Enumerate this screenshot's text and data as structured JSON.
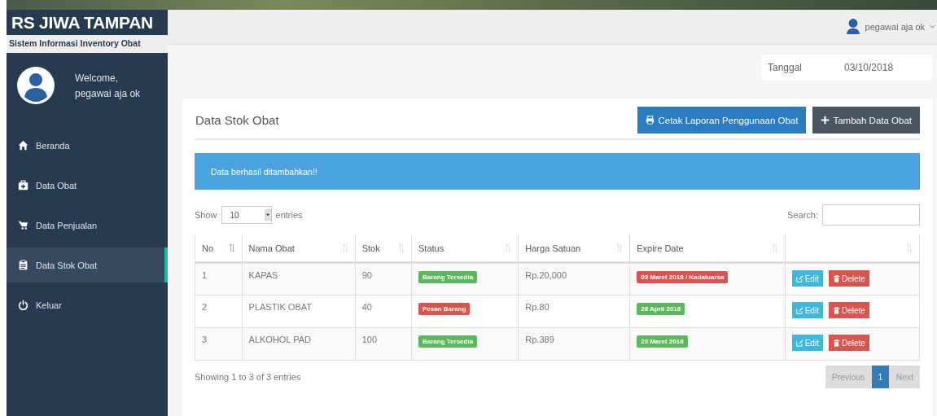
{
  "brand": {
    "title": "RS JIWA TAMPAN",
    "subtitle": "Sistem Informasi Inventory Obat"
  },
  "user": {
    "welcome": "Welcome,",
    "name": "pegawai aja ok",
    "menu_label": "pegawai aja ok"
  },
  "sidebar": {
    "items": [
      {
        "label": "Beranda",
        "kind": "home",
        "selected": false
      },
      {
        "label": "Data Obat",
        "kind": "medkit",
        "selected": false
      },
      {
        "label": "Data Penjualan",
        "kind": "cart",
        "selected": false
      },
      {
        "label": "Data Stok Obat",
        "kind": "clipboard",
        "selected": true
      },
      {
        "label": "Keluar",
        "kind": "power",
        "selected": false
      }
    ]
  },
  "date": {
    "label": "Tanggal",
    "value": "03/10/2018"
  },
  "panel": {
    "title": "Data Stok Obat",
    "buttons": [
      {
        "label": "Cetak Laporan Penggunaan Obat",
        "kind": "print"
      },
      {
        "label": "Tambah Data Obat",
        "kind": "add"
      }
    ]
  },
  "alert": "Data berhasil ditambahkan!!",
  "table": {
    "show_label": "Show",
    "page_size": "10",
    "entries_label": "entries",
    "search_label": "Search:",
    "columns": [
      "No",
      "Nama Obat",
      "Stok",
      "Status",
      "Harga Satuan",
      "Expire Date",
      ""
    ],
    "rows": [
      {
        "no": "1",
        "name": "KAPAS",
        "stock": "90",
        "status": {
          "text": "Barang Tersedia",
          "color": "#5cb85c"
        },
        "price": "Rp.20,000",
        "expire": {
          "text": "03 Maret 2018 / Kadaluarsa",
          "color": "#d9534f"
        },
        "actions": [
          "Edit",
          "Delete"
        ]
      },
      {
        "no": "2",
        "name": "PLASTIK OBAT",
        "stock": "40",
        "status": {
          "text": "Pesan Barang",
          "color": "#d9534f"
        },
        "price": "Rp.80",
        "expire": {
          "text": "28 April 2018",
          "color": "#5cb85c"
        },
        "actions": [
          "Edit",
          "Delete"
        ]
      },
      {
        "no": "3",
        "name": "ALKOHOL PAD",
        "stock": "100",
        "status": {
          "text": "Barang Tersedia",
          "color": "#5cb85c"
        },
        "price": "Rp.389",
        "expire": {
          "text": "23 Maret 2018",
          "color": "#5cb85c"
        },
        "actions": [
          "Edit",
          "Delete"
        ]
      }
    ],
    "info": "Showing 1 to 3 of 3 entries",
    "pagination": [
      {
        "label": "Previous",
        "selected": false,
        "disabled": true
      },
      {
        "label": "1",
        "selected": true,
        "disabled": false
      },
      {
        "label": "Next",
        "selected": false,
        "disabled": true
      }
    ]
  }
}
